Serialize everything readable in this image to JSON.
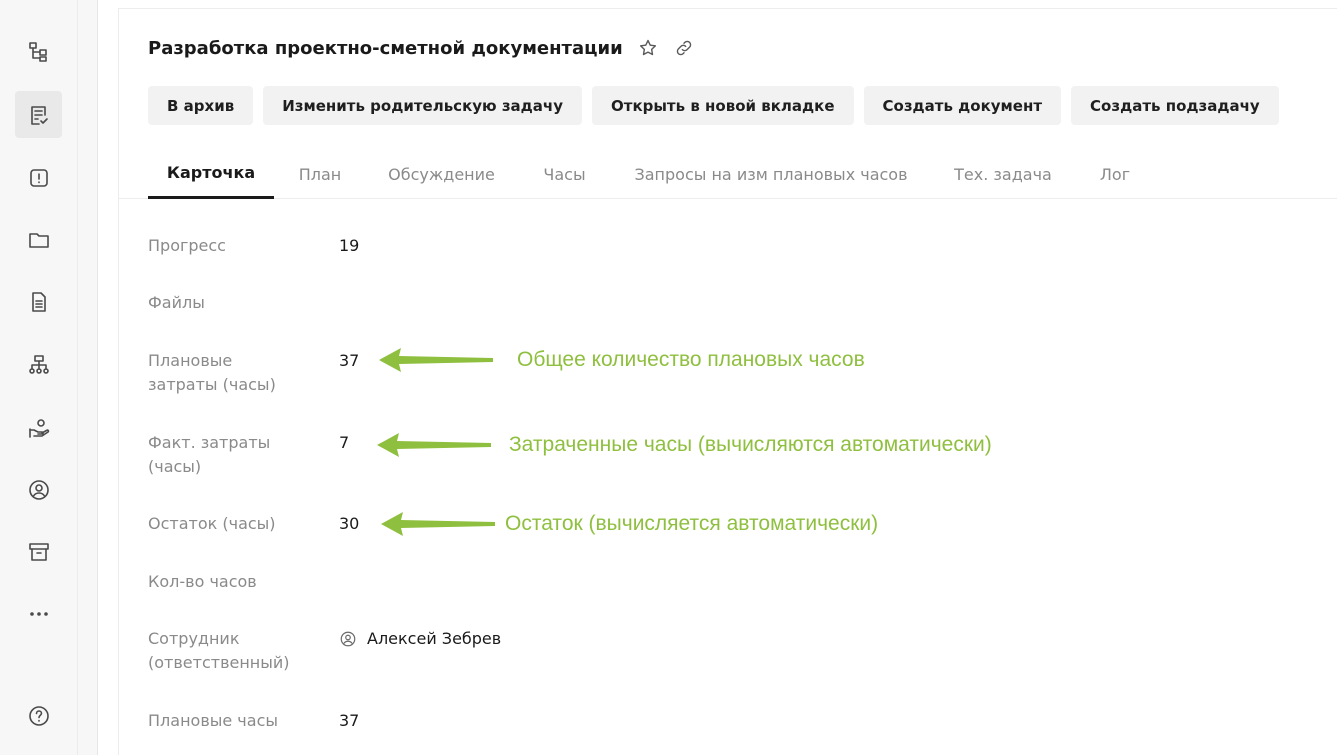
{
  "sidebar": {
    "items": [
      {
        "icon": "hierarchy-icon"
      },
      {
        "icon": "task-list-icon",
        "active": true
      },
      {
        "icon": "alert-icon"
      },
      {
        "icon": "folder-icon"
      },
      {
        "icon": "document-icon"
      },
      {
        "icon": "org-structure-icon"
      },
      {
        "icon": "hand-coins-icon"
      },
      {
        "icon": "user-circle-icon"
      },
      {
        "icon": "archive-icon"
      },
      {
        "icon": "more-icon"
      },
      {
        "icon": "help-icon"
      }
    ]
  },
  "header": {
    "title": "Разработка проектно-сметной документации"
  },
  "actions": {
    "archive": "В архив",
    "change_parent": "Изменить родительскую задачу",
    "open_new_tab": "Открыть в новой вкладке",
    "create_document": "Создать документ",
    "create_subtask": "Создать подзадачу"
  },
  "tabs": [
    {
      "label": "Карточка",
      "active": true
    },
    {
      "label": "План"
    },
    {
      "label": "Обсуждение"
    },
    {
      "label": "Часы"
    },
    {
      "label": "Запросы на изм плановых часов"
    },
    {
      "label": "Тех. задача"
    },
    {
      "label": "Лог"
    }
  ],
  "fields": {
    "progress": {
      "label": "Прогресс",
      "value": "19"
    },
    "files": {
      "label": "Файлы",
      "value": ""
    },
    "planned_costs": {
      "label": "Плановые затраты (часы)",
      "value": "37"
    },
    "actual_costs": {
      "label": "Факт. затраты (часы)",
      "value": "7"
    },
    "remaining": {
      "label": "Остаток (часы)",
      "value": "30"
    },
    "hours_count": {
      "label": "Кол-во часов",
      "value": ""
    },
    "employee": {
      "label": "Сотрудник (ответственный)",
      "value": "Алексей Зебрев"
    },
    "planned_hours": {
      "label": "Плановые часы",
      "value": "37"
    }
  },
  "annotations": {
    "planned": "Общее количество плановых часов",
    "spent": "Затраченные часы (вычисляются автоматически)",
    "remaining": "Остаток (вычисляется автоматически)",
    "color": "#8fbf3f"
  }
}
